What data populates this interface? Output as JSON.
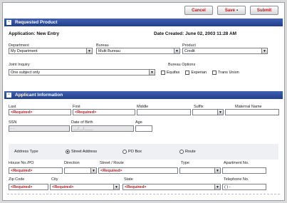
{
  "toolbar": {
    "cancel_label": "Cancel",
    "save_label": "Save",
    "submit_label": "Submit"
  },
  "requested_product": {
    "section_title": "Requested Product",
    "application_label": "Application: New Entry",
    "date_created": "Date Created: June 02, 2003 11:28 AM",
    "department": {
      "label": "Department",
      "value": "My Department"
    },
    "bureau": {
      "label": "Bureau",
      "value": "Multi Bureau"
    },
    "product": {
      "label": "Product",
      "value": "Credit"
    },
    "joint_inquiry": {
      "label": "Joint Inquiry",
      "value": "One subject only"
    },
    "bureau_options": {
      "label": "Bureau Options",
      "options": [
        "Equifax",
        "Experian",
        "Trans Union"
      ]
    }
  },
  "applicant": {
    "section_title": "Applicant Information",
    "last": {
      "label": "Last",
      "value": "<Required>"
    },
    "first": {
      "label": "First",
      "value": "<Required>"
    },
    "middle": {
      "label": "Middle",
      "value": ""
    },
    "suffix": {
      "label": "Suffix",
      "value": ""
    },
    "maternal": {
      "label": "Maternal Name",
      "value": ""
    },
    "ssn": {
      "label": "SSN",
      "value": "- -"
    },
    "dob": {
      "label": "Date of Birth",
      "value": "__/__/____"
    },
    "age": {
      "label": "Age",
      "value": ""
    },
    "address_type": {
      "label": "Address Type",
      "options": [
        "Street Address",
        "PO Box",
        "Route"
      ],
      "selected": "Street Address"
    },
    "house_no": {
      "label": "House No./PO",
      "value": "<Required>"
    },
    "direction": {
      "label": "Direction",
      "value": ""
    },
    "street": {
      "label": "Street / Route",
      "value": "<Required>"
    },
    "type": {
      "label": "Type",
      "value": ""
    },
    "apartment": {
      "label": "Apartment No.",
      "value": ""
    },
    "zip": {
      "label": "Zip Code",
      "value": "<Required>"
    },
    "city": {
      "label": "City",
      "value": "<Required>"
    },
    "state": {
      "label": "State",
      "value": "<Required>"
    },
    "telephone": {
      "label": "Telephone No.",
      "value": "( ) -"
    }
  },
  "colors": {
    "section_bar": "#213f8c",
    "required_text": "#c0141a"
  }
}
